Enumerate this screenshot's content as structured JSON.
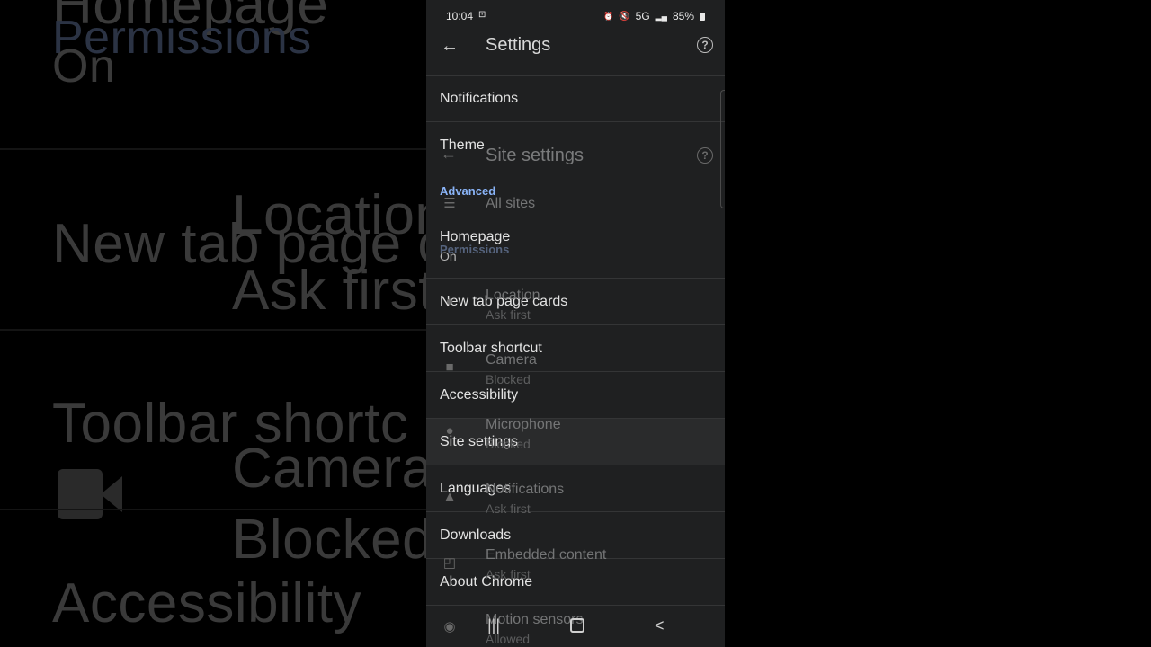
{
  "status_bar": {
    "time": "10:04",
    "screenshot_icon": "screenshot-icon",
    "network": "5G",
    "battery": "85%"
  },
  "app_bar": {
    "title": "Settings",
    "back_icon": "arrow-left-icon",
    "help_icon": "help-circle-icon"
  },
  "settings_items": [
    {
      "label": "Notifications"
    },
    {
      "label": "Theme"
    },
    {
      "section": "Advanced"
    },
    {
      "label": "Homepage",
      "sub": "On"
    },
    {
      "label": "New tab page cards"
    },
    {
      "label": "Toolbar shortcut"
    },
    {
      "label": "Accessibility"
    },
    {
      "label": "Site settings"
    },
    {
      "label": "Languages"
    },
    {
      "label": "Downloads"
    },
    {
      "label": "About Chrome"
    }
  ],
  "site_settings_overlay": {
    "title": "Site settings",
    "all_sites": "All sites",
    "permissions_section": "Permissions",
    "items": [
      {
        "label": "Location",
        "sub": "Ask first",
        "icon": "location-pin-icon"
      },
      {
        "label": "Camera",
        "sub": "Blocked",
        "icon": "camera-icon"
      },
      {
        "label": "Microphone",
        "sub": "Blocked",
        "icon": "microphone-icon"
      },
      {
        "label": "Notifications",
        "sub": "Ask first",
        "icon": "bell-icon"
      },
      {
        "label": "Embedded content",
        "sub": "Ask first",
        "icon": "embedded-content-icon"
      },
      {
        "label": "Motion sensors",
        "sub": "Allowed",
        "icon": "motion-sensor-icon"
      }
    ]
  },
  "background_echo": [
    "Homepage",
    "Permissions",
    "On",
    "Location",
    "New tab page c",
    "Ask first",
    "Toolbar shortc",
    "Camera",
    "Blocked",
    "Accessibility"
  ]
}
